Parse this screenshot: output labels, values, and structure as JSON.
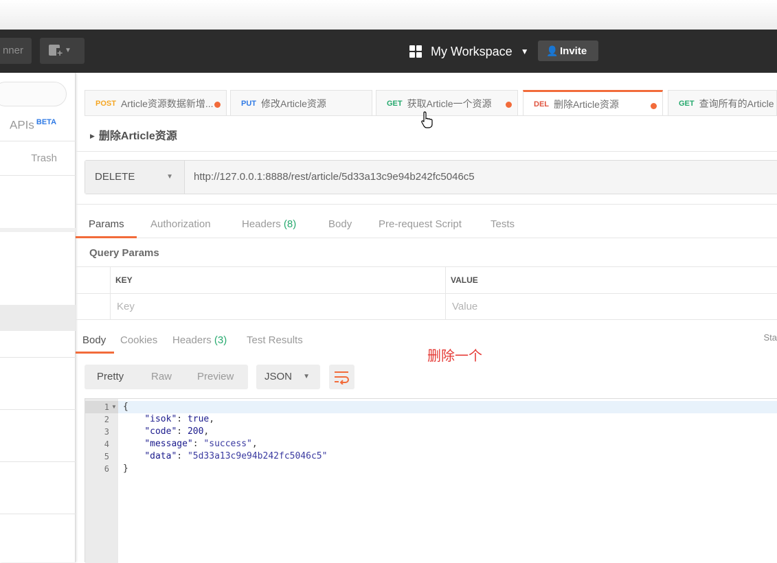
{
  "header": {
    "runner_label": "nner",
    "workspace_label": "My Workspace",
    "invite_label": "Invite"
  },
  "sidebar": {
    "apis_label": "APIs",
    "apis_badge": "BETA",
    "trash_label": "Trash"
  },
  "tabs": [
    {
      "method": "POST",
      "title": "Article资源数据新增...",
      "unsaved": true
    },
    {
      "method": "PUT",
      "title": "修改Article资源",
      "unsaved": false
    },
    {
      "method": "GET",
      "title": "获取Article一个资源",
      "unsaved": true
    },
    {
      "method": "DEL",
      "title": "删除Article资源",
      "unsaved": true,
      "active": true
    },
    {
      "method": "GET",
      "title": "查询所有的Article",
      "unsaved": false
    }
  ],
  "request": {
    "title": "删除Article资源",
    "method": "DELETE",
    "url": "http://127.0.0.1:8888/rest/article/5d33a13c9e94b242fc5046c5"
  },
  "request_tabs": {
    "params": "Params",
    "authorization": "Authorization",
    "headers": "Headers",
    "headers_count": "(8)",
    "body": "Body",
    "prerequest": "Pre-request Script",
    "tests": "Tests"
  },
  "query_params": {
    "label": "Query Params",
    "key_header": "KEY",
    "value_header": "VALUE",
    "key_placeholder": "Key",
    "value_placeholder": "Value"
  },
  "response_tabs": {
    "body": "Body",
    "cookies": "Cookies",
    "headers": "Headers",
    "headers_count": "(3)",
    "test_results": "Test Results",
    "status_cut": "Sta"
  },
  "annotation": "删除一个",
  "view": {
    "pretty": "Pretty",
    "raw": "Raw",
    "preview": "Preview",
    "format": "JSON"
  },
  "response_body": {
    "line_numbers": [
      "1",
      "2",
      "3",
      "4",
      "5",
      "6"
    ],
    "lines": {
      "l1": "{",
      "l2_key": "\"isok\"",
      "l2_val": "true",
      "l3_key": "\"code\"",
      "l3_val": "200",
      "l4_key": "\"message\"",
      "l4_val": "\"success\"",
      "l5_key": "\"data\"",
      "l5_val": "\"5d33a13c9e94b242fc5046c5\"",
      "l6": "}"
    }
  },
  "colors": {
    "accent": "#f26b3a",
    "header_bg": "#2c2c2c",
    "method_post": "#f5a623",
    "method_put": "#2f7ae5",
    "method_get": "#26a96e",
    "method_del": "#e0533e",
    "annotation": "#e53935"
  }
}
